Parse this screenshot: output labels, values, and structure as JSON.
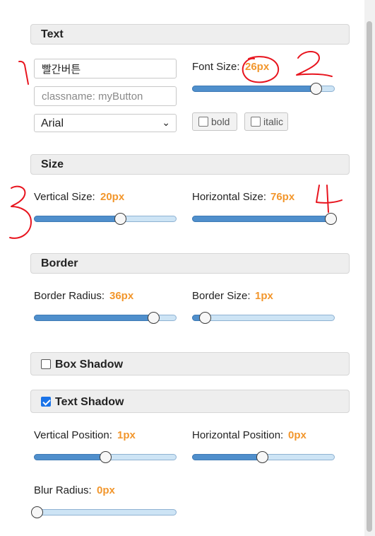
{
  "sections": {
    "text": "Text",
    "size": "Size",
    "border": "Border",
    "box_shadow": "Box Shadow",
    "text_shadow": "Text Shadow"
  },
  "text_panel": {
    "button_text_value": "빨간버튼",
    "classname_placeholder": "classname: myButton",
    "font_family": "Arial",
    "font_size_label": "Font Size:",
    "font_size_value": "26px",
    "font_size_level": 0.88,
    "bold_label": "bold",
    "italic_label": "italic",
    "bold_checked": false,
    "italic_checked": false
  },
  "size_panel": {
    "vertical_label": "Vertical Size:",
    "vertical_value": "20px",
    "vertical_level": 0.61,
    "horizontal_label": "Horizontal Size:",
    "horizontal_value": "76px",
    "horizontal_level": 0.99
  },
  "border_panel": {
    "radius_label": "Border Radius:",
    "radius_value": "36px",
    "radius_level": 0.85,
    "size_label": "Border Size:",
    "size_value": "1px",
    "size_level": 0.07
  },
  "box_shadow_checked": false,
  "text_shadow_checked": true,
  "text_shadow_panel": {
    "vpos_label": "Vertical Position:",
    "vpos_value": "1px",
    "vpos_level": 0.5,
    "hpos_label": "Horizontal Position:",
    "hpos_value": "0px",
    "hpos_level": 0.49,
    "blur_label": "Blur Radius:",
    "blur_value": "0px",
    "blur_level": 0.0
  },
  "annotations": [
    "1",
    "2",
    "3",
    "4"
  ],
  "colors": {
    "value_accent": "#f2962c",
    "slider_fill": "#4f8fcc",
    "slider_track": "#cde4f5",
    "checkbox_checked": "#1a73e8",
    "annotation_ink": "#e8141e"
  }
}
